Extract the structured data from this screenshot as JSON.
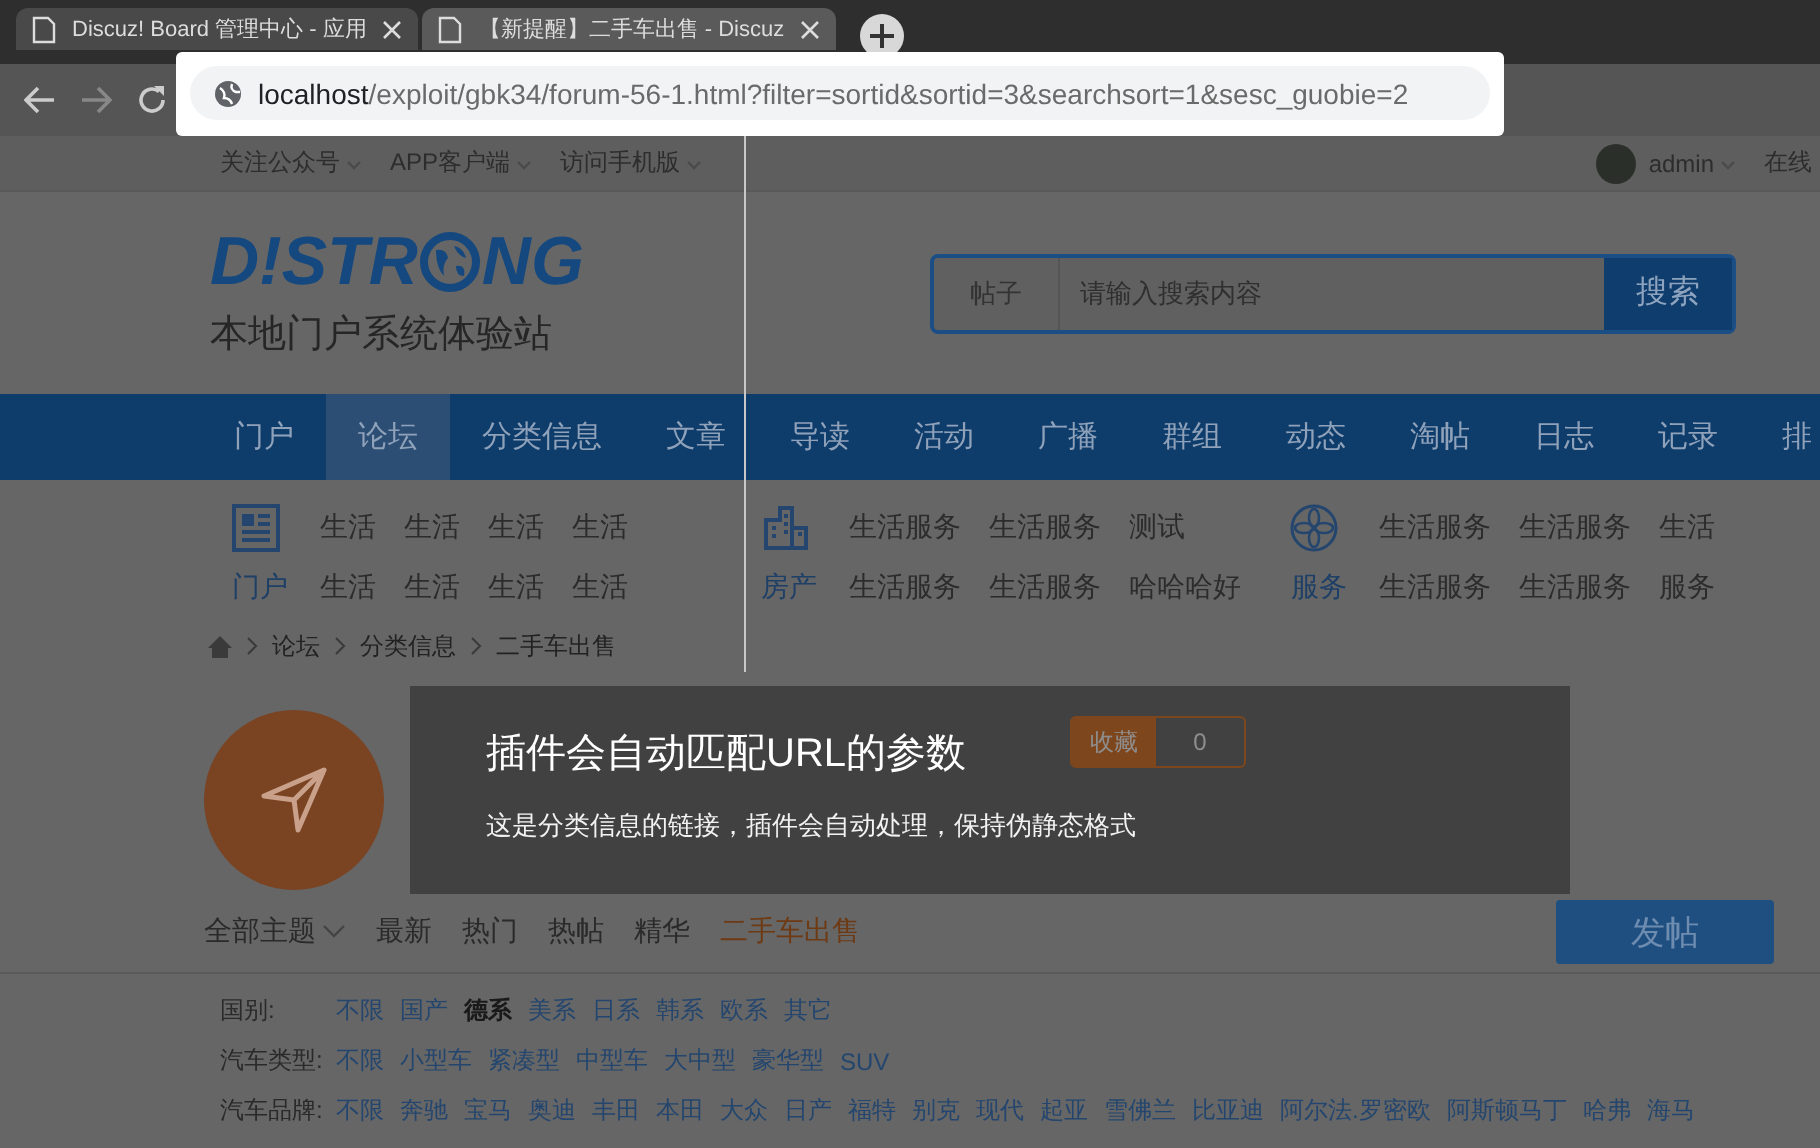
{
  "browser": {
    "tabs": [
      {
        "title": "Discuz! Board 管理中心 - 应用",
        "selected": false
      },
      {
        "title": "【新提醒】二手车出售 - Discuz",
        "selected": true
      }
    ],
    "address": {
      "host": "localhost",
      "path": "/exploit/gbk34/forum-56-1.html?filter=sortid&sortid=3&searchsort=1&sesc_guobie=2"
    }
  },
  "topbar": {
    "links": [
      "关注公众号",
      "APP客户端",
      "访问手机版"
    ],
    "user": "admin",
    "status": "在线"
  },
  "header": {
    "logo": [
      "D!STR",
      "NG"
    ],
    "subtitle": "本地门户系统体验站",
    "search": {
      "scope": "帖子",
      "placeholder": "请输入搜索内容",
      "button": "搜索"
    }
  },
  "nav": [
    {
      "label": "门户",
      "selected": false
    },
    {
      "label": "论坛",
      "selected": true
    },
    {
      "label": "分类信息",
      "selected": false
    },
    {
      "label": "文章",
      "selected": false
    },
    {
      "label": "导读",
      "selected": false
    },
    {
      "label": "活动",
      "selected": false
    },
    {
      "label": "广播",
      "selected": false
    },
    {
      "label": "群组",
      "selected": false
    },
    {
      "label": "动态",
      "selected": false
    },
    {
      "label": "淘帖",
      "selected": false
    },
    {
      "label": "日志",
      "selected": false
    },
    {
      "label": "记录",
      "selected": false
    },
    {
      "label": "排",
      "selected": false
    }
  ],
  "subnav": [
    {
      "kind": "portal",
      "label": "门户",
      "links": [
        "生活",
        "生活",
        "生活",
        "生活",
        "生活",
        "生活",
        "生活",
        "生活"
      ]
    },
    {
      "kind": "house",
      "label": "房产",
      "links": [
        "生活服务",
        "生活服务",
        "测试",
        "生活服务",
        "生活服务",
        "哈哈哈好"
      ]
    },
    {
      "kind": "service",
      "label": "服务",
      "links": [
        "生活服务",
        "生活服务",
        "生活",
        "生活服务",
        "生活服务",
        "服务"
      ]
    }
  ],
  "breadcrumb": [
    "论坛",
    "分类信息",
    "二手车出售"
  ],
  "forum": {
    "favorite": {
      "label": "收藏",
      "count": "0"
    }
  },
  "thread_tabs": [
    {
      "label": "全部主题",
      "kind": "dropdown",
      "selected": false
    },
    {
      "label": "最新",
      "kind": "link",
      "selected": false
    },
    {
      "label": "热门",
      "kind": "link",
      "selected": false
    },
    {
      "label": "热帖",
      "kind": "link",
      "selected": false
    },
    {
      "label": "精华",
      "kind": "link",
      "selected": false
    },
    {
      "label": "二手车出售",
      "kind": "link",
      "selected": true
    }
  ],
  "post_button": "发帖",
  "filters": [
    {
      "label": "国别:",
      "options": [
        {
          "label": "不限",
          "selected": false
        },
        {
          "label": "国产",
          "selected": false
        },
        {
          "label": "德系",
          "selected": true
        },
        {
          "label": "美系",
          "selected": false
        },
        {
          "label": "日系",
          "selected": false
        },
        {
          "label": "韩系",
          "selected": false
        },
        {
          "label": "欧系",
          "selected": false
        },
        {
          "label": "其它",
          "selected": false
        }
      ]
    },
    {
      "label": "汽车类型:",
      "options": [
        {
          "label": "不限",
          "selected": false
        },
        {
          "label": "小型车",
          "selected": false
        },
        {
          "label": "紧凑型",
          "selected": false
        },
        {
          "label": "中型车",
          "selected": false
        },
        {
          "label": "大中型",
          "selected": false
        },
        {
          "label": "豪华型",
          "selected": false
        },
        {
          "label": "SUV",
          "selected": false
        }
      ]
    },
    {
      "label": "汽车品牌:",
      "options": [
        {
          "label": "不限",
          "selected": false
        },
        {
          "label": "奔驰",
          "selected": false
        },
        {
          "label": "宝马",
          "selected": false
        },
        {
          "label": "奥迪",
          "selected": false
        },
        {
          "label": "丰田",
          "selected": false
        },
        {
          "label": "本田",
          "selected": false
        },
        {
          "label": "大众",
          "selected": false
        },
        {
          "label": "日产",
          "selected": false
        },
        {
          "label": "福特",
          "selected": false
        },
        {
          "label": "别克",
          "selected": false
        },
        {
          "label": "现代",
          "selected": false
        },
        {
          "label": "起亚",
          "selected": false
        },
        {
          "label": "雪佛兰",
          "selected": false
        },
        {
          "label": "比亚迪",
          "selected": false
        },
        {
          "label": "阿尔法.罗密欧",
          "selected": false
        },
        {
          "label": "阿斯顿马丁",
          "selected": false
        },
        {
          "label": "哈弗",
          "selected": false
        },
        {
          "label": "海马",
          "selected": false
        }
      ]
    }
  ],
  "tooltip": {
    "title": "插件会自动匹配URL的参数",
    "text": "这是分类信息的链接，插件会自动处理，保持伪静态格式"
  }
}
